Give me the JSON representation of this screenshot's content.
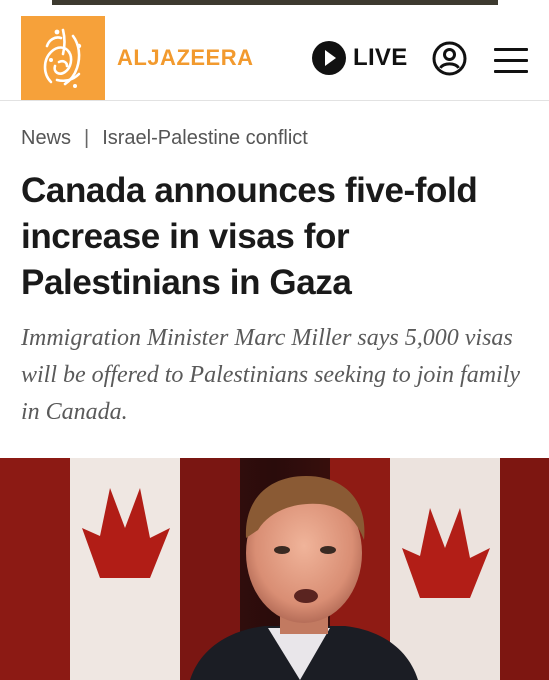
{
  "header": {
    "brand_name": "ALJAZEERA",
    "live_label": "LIVE",
    "icons": {
      "logo": "al-jazeera-calligraphy-logo",
      "live": "play-circle-icon",
      "account": "user-account-icon",
      "menu": "hamburger-menu-icon"
    },
    "colors": {
      "brand": "#f6a13a",
      "text": "#111111"
    }
  },
  "breadcrumb": {
    "section": "News",
    "separator": "|",
    "topic": "Israel-Palestine conflict"
  },
  "article": {
    "headline": "Canada announces five-fold increase in visas for Palestinians in Gaza",
    "subheadline": "Immigration Minister Marc Miller says 5,000 visas will be offered to Palestinians seeking to join family in Canada."
  },
  "hero_image": {
    "description_icon": "photo-of-minister-speaking-in-front-of-canadian-flags"
  }
}
